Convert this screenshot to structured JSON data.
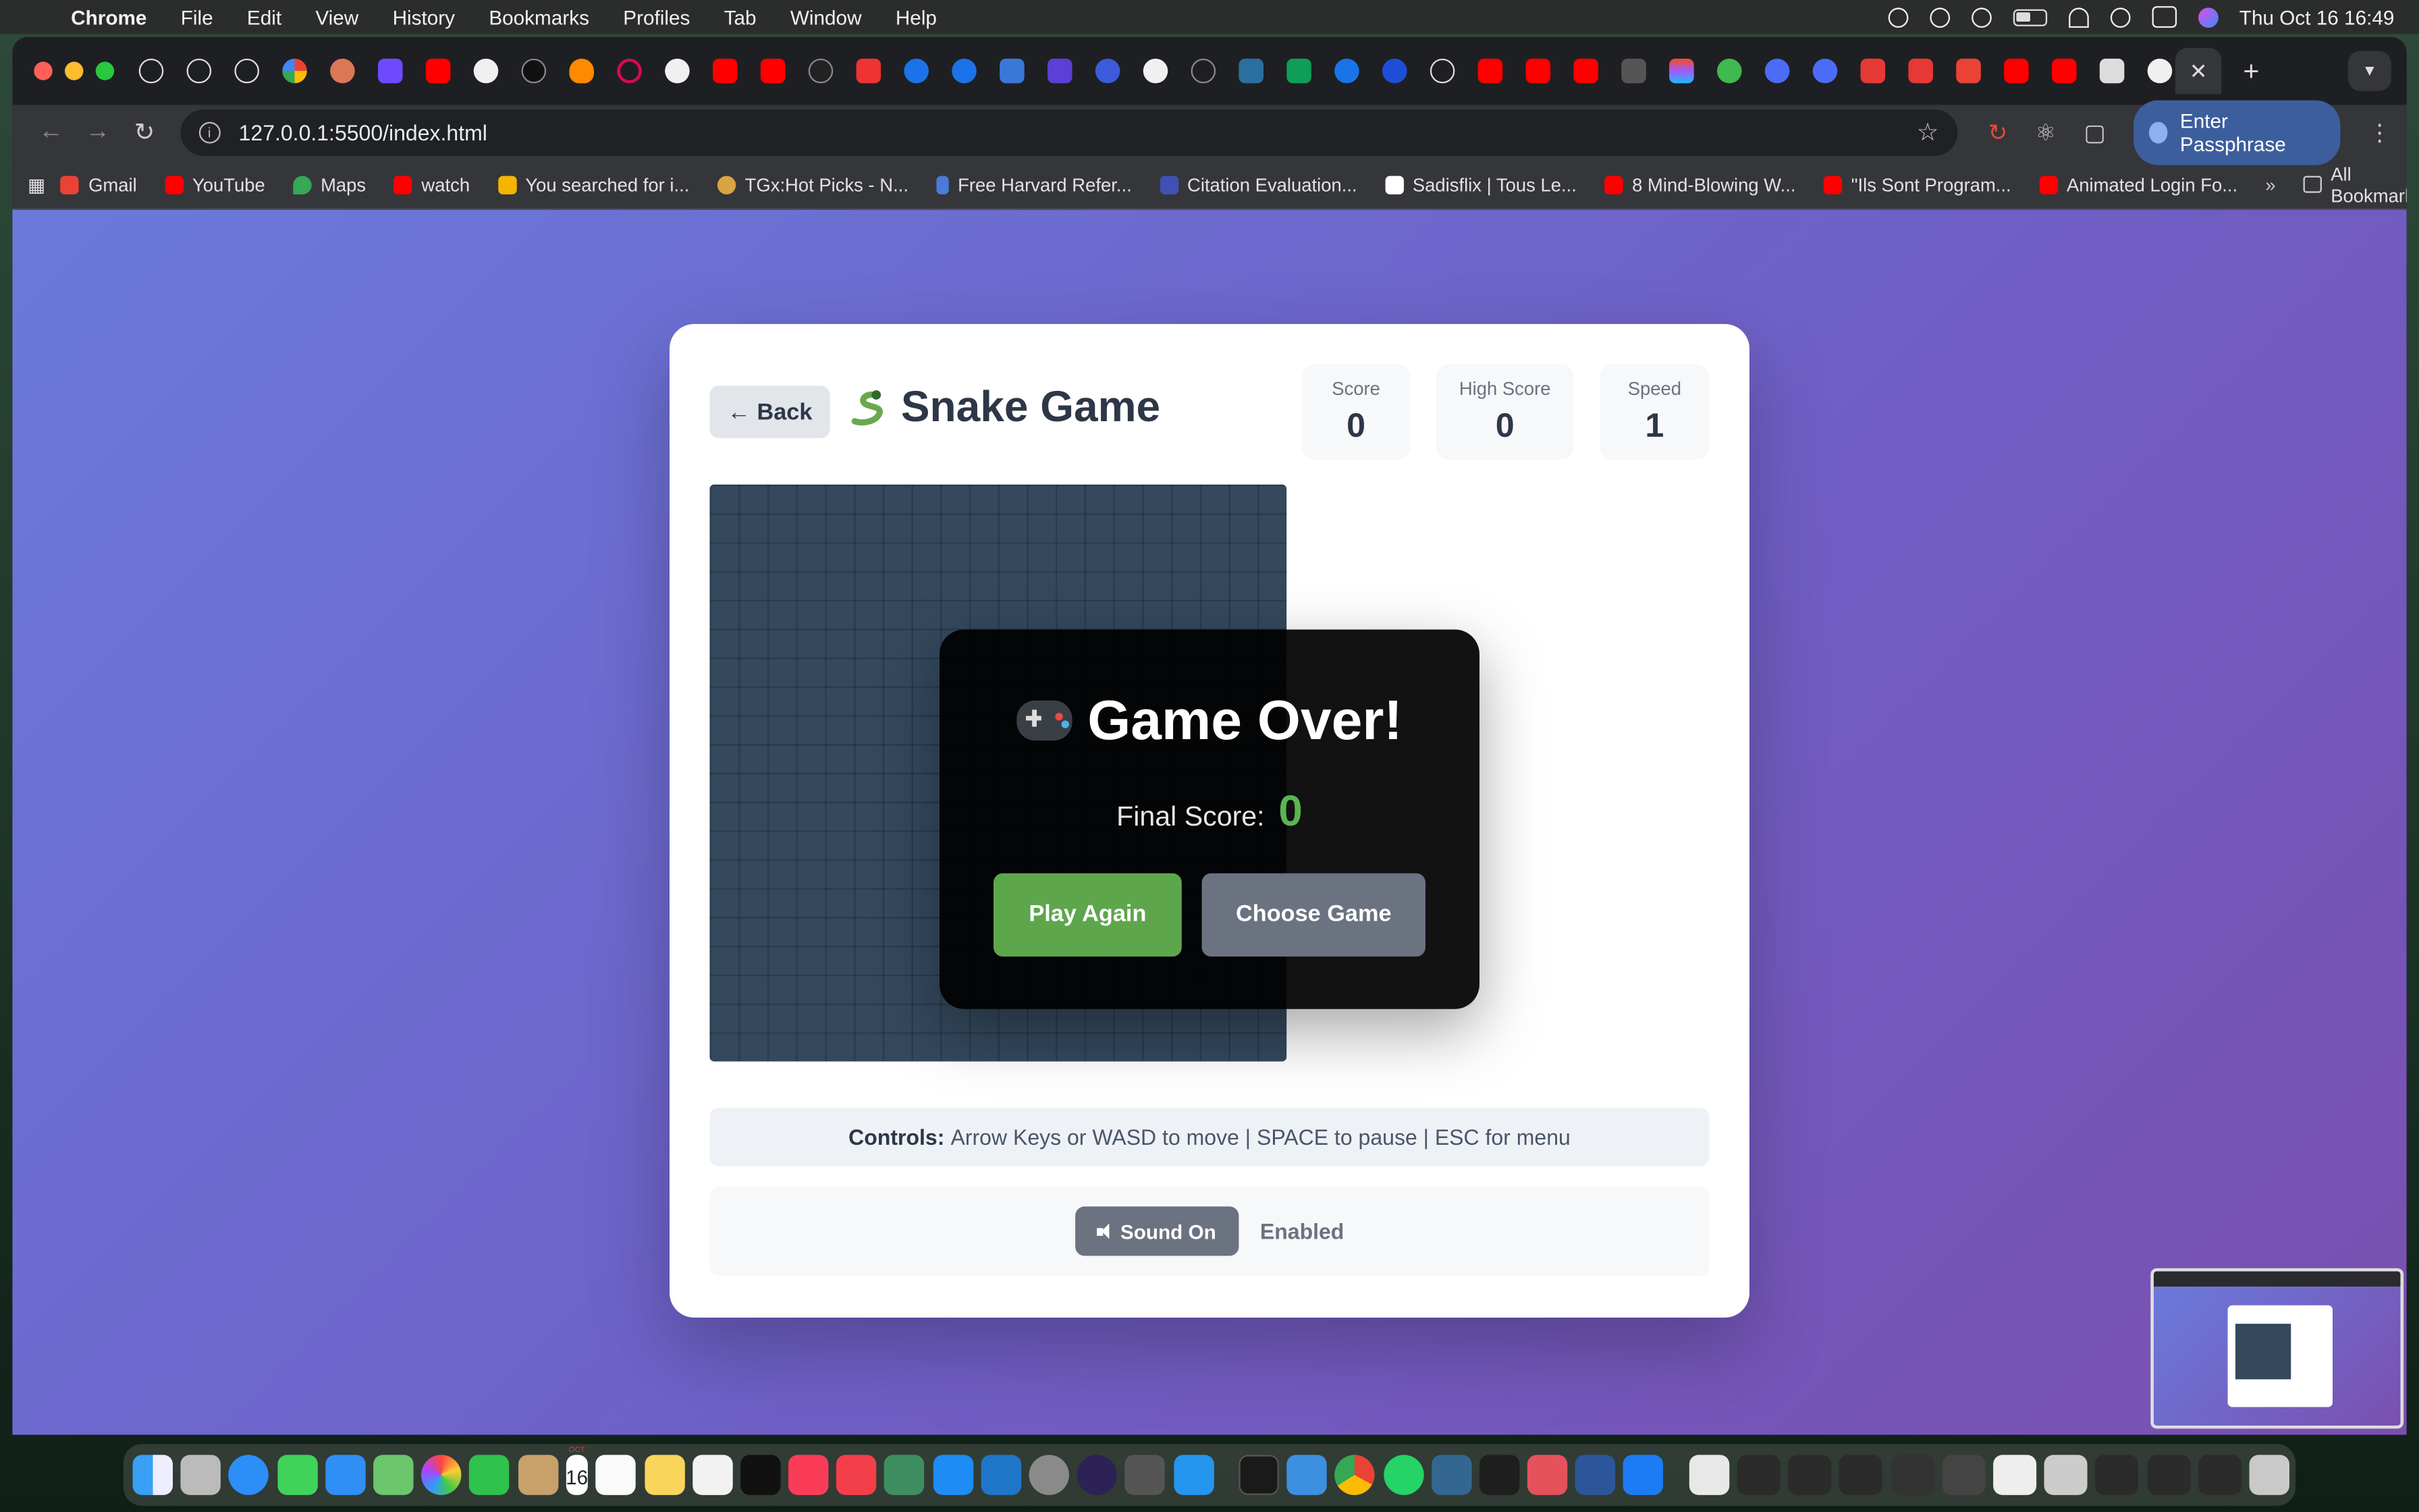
{
  "menubar": {
    "app": "Chrome",
    "items": [
      "File",
      "Edit",
      "View",
      "History",
      "Bookmarks",
      "Profiles",
      "Tab",
      "Window",
      "Help"
    ],
    "clock": "Thu Oct 16  16:49"
  },
  "browser": {
    "url": "127.0.0.1:5500/index.html",
    "passphrase_button": "Enter Passphrase",
    "bookmarks": [
      {
        "label": "Gmail",
        "color": "#ea4335"
      },
      {
        "label": "YouTube",
        "color": "#ff0000"
      },
      {
        "label": "Maps",
        "color": "#34a853"
      },
      {
        "label": "watch",
        "color": "#ff0000"
      },
      {
        "label": "You searched for i...",
        "color": "#f4b400"
      },
      {
        "label": "TGx:Hot Picks - N...",
        "color": "#d9a441"
      },
      {
        "label": "Free Harvard Refer...",
        "color": "#4a7bd8"
      },
      {
        "label": "Citation Evaluation...",
        "color": "#3f51b5"
      },
      {
        "label": "Sadisflix | Tous Le...",
        "color": "#ffffff"
      },
      {
        "label": "8 Mind-Blowing W...",
        "color": "#ff0000"
      },
      {
        "label": "\"Ils Sont Program...",
        "color": "#ff0000"
      },
      {
        "label": "Animated Login Fo...",
        "color": "#ff0000"
      }
    ],
    "all_bookmarks": "All Bookmarks",
    "more": "»"
  },
  "game": {
    "back_label": "← Back",
    "title": "Snake Game",
    "stats": {
      "score_label": "Score",
      "score_value": "0",
      "high_label": "High Score",
      "high_value": "0",
      "speed_label": "Speed",
      "speed_value": "1"
    },
    "overlay": {
      "title": "Game Over!",
      "final_label": "Final Score:",
      "final_value": "0",
      "play_again": "Play Again",
      "choose_game": "Choose Game"
    },
    "controls": {
      "label": "Controls:",
      "text": "Arrow Keys or WASD to move | SPACE to pause | ESC for menu"
    },
    "sound": {
      "button": "Sound On",
      "status": "Enabled"
    }
  },
  "dock": {
    "calendar_day": "16"
  },
  "colors": {
    "page_gradient_start": "#6a7adb",
    "page_gradient_end": "#7a4fb0",
    "board": "#34495e",
    "play_button": "#5ea64c",
    "secondary_button": "#6b7280",
    "score_green": "#5ab552"
  }
}
